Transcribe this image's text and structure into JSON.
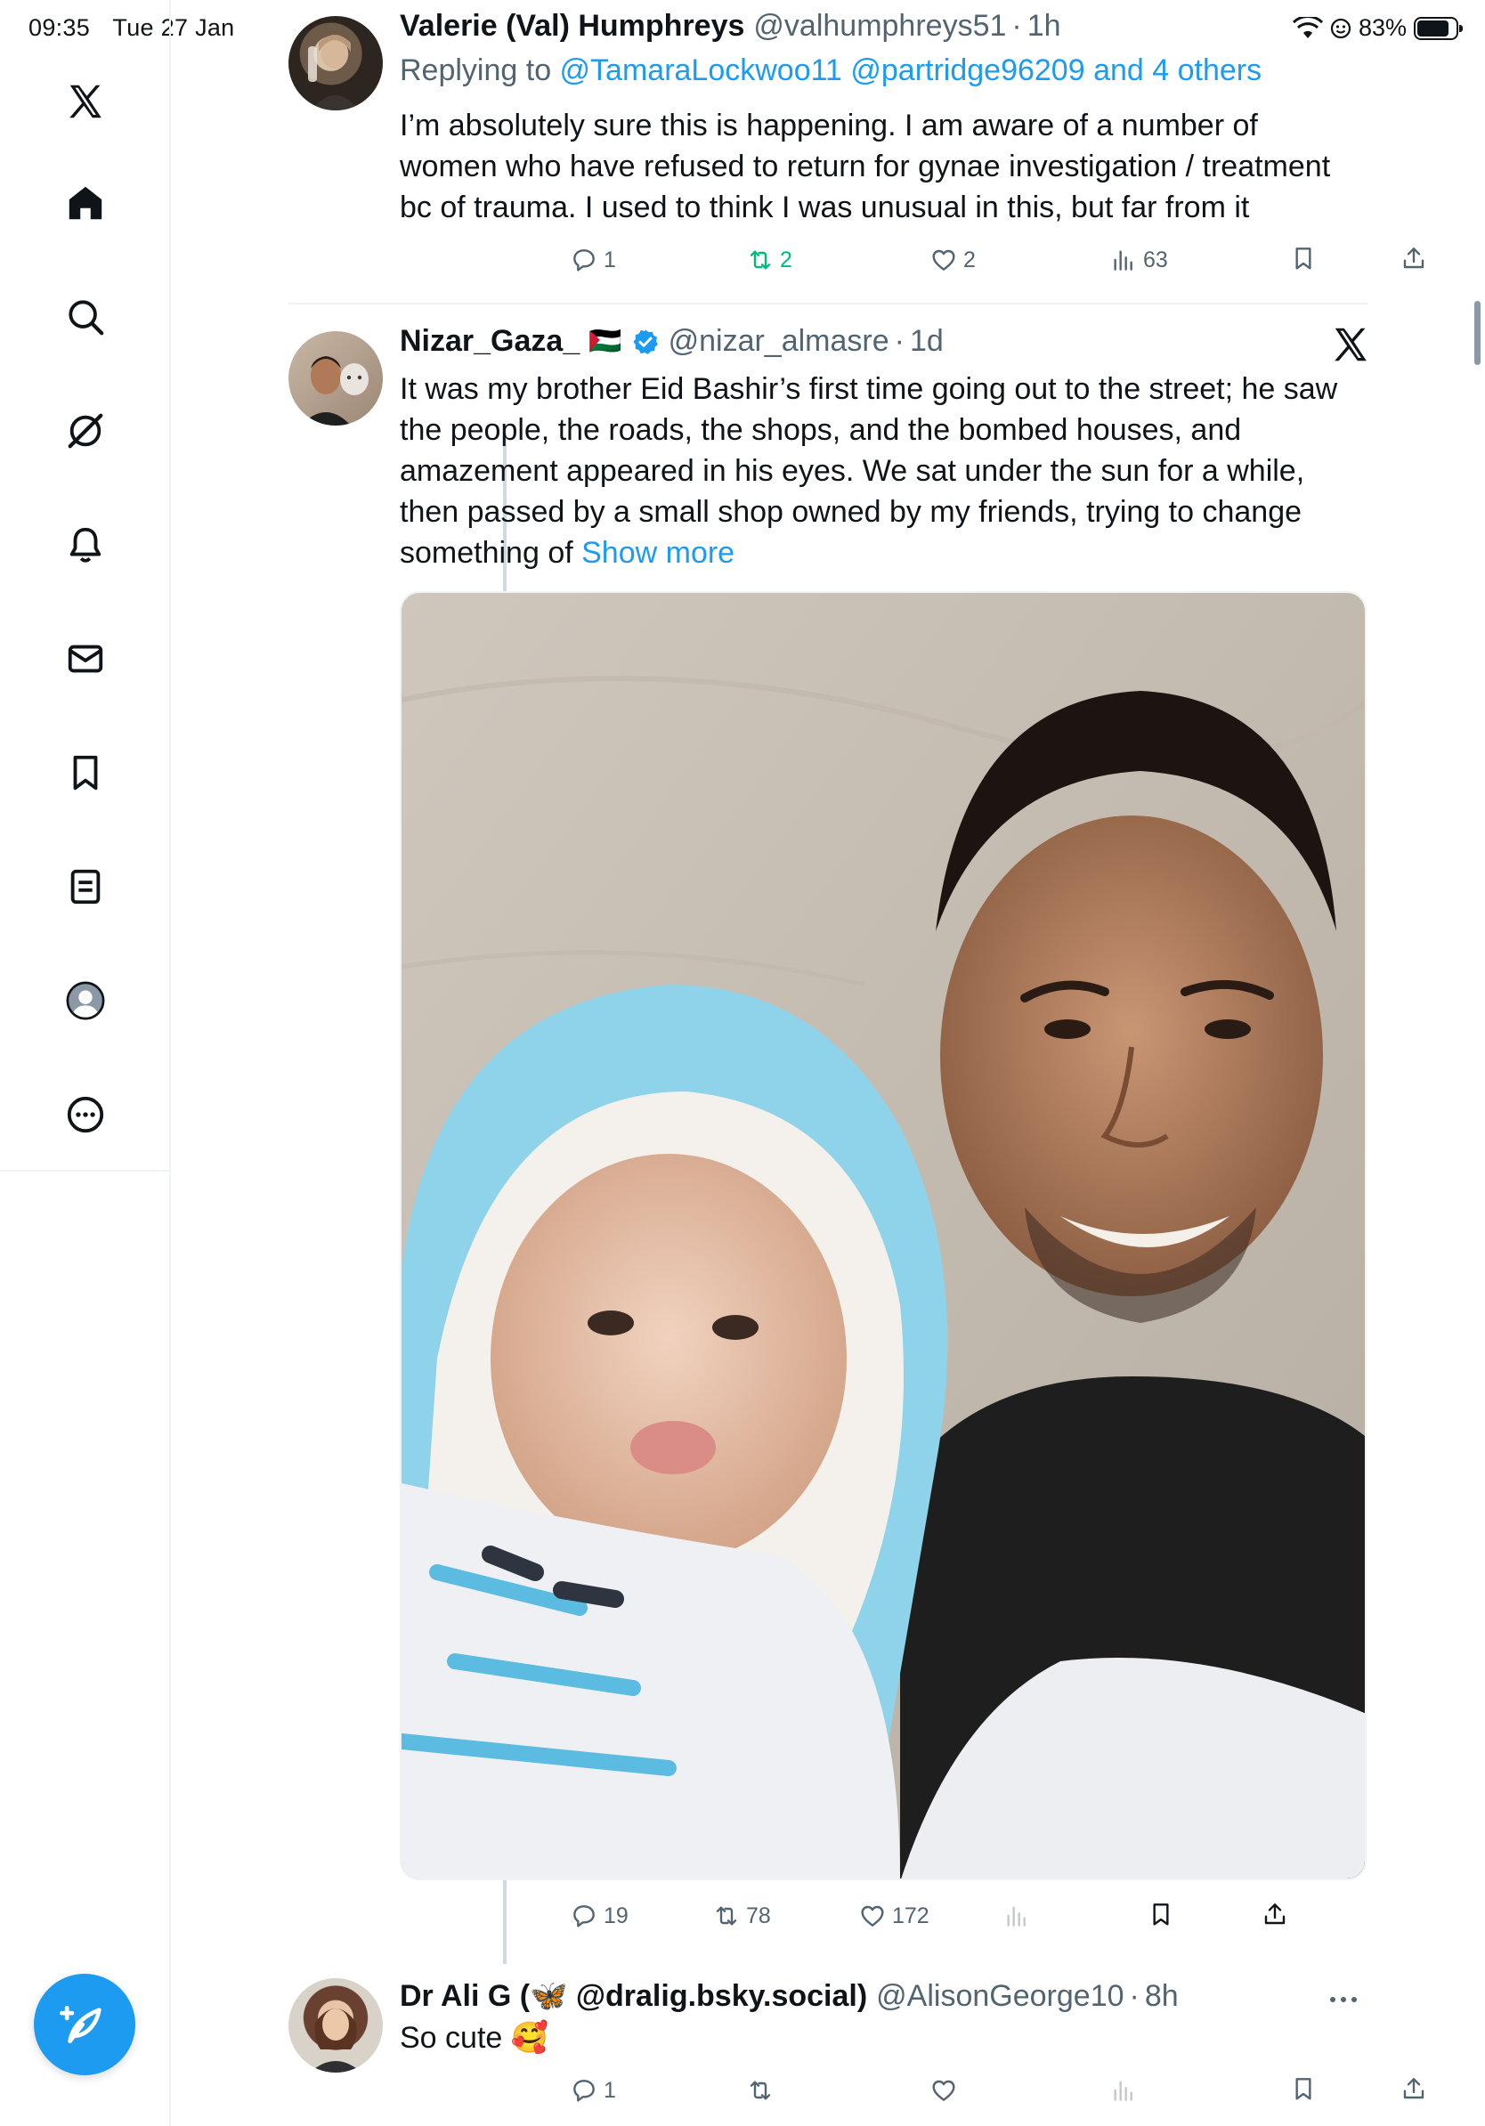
{
  "status_bar": {
    "time": "09:35",
    "date": "Tue 27 Jan",
    "battery": "83%",
    "battery_level": 0.83
  },
  "sidebar": {
    "items": [
      {
        "name": "x-logo-icon"
      },
      {
        "name": "home-icon"
      },
      {
        "name": "search-icon"
      },
      {
        "name": "grok-icon"
      },
      {
        "name": "notifications-icon"
      },
      {
        "name": "messages-icon"
      },
      {
        "name": "bookmarks-icon"
      },
      {
        "name": "lists-icon"
      },
      {
        "name": "profile-icon"
      },
      {
        "name": "more-icon"
      }
    ],
    "compose_icon": "compose-icon"
  },
  "tweets": [
    {
      "name": "Valerie (Val) Humphreys",
      "handle": "@valhumphreys51",
      "dot": "·",
      "time": "1h",
      "replying_prefix": "Replying to ",
      "replying_links": "@TamaraLockwoo11 @partridge96209 and 4 others",
      "text": "I’m absolutely sure this is happening. I am aware of a number of women who have refused to return for gynae investigation / treatment bc of trauma. I used to think I was unusual in this, but far from it",
      "replies": "1",
      "retweets": "2",
      "likes": "2",
      "views": "63"
    },
    {
      "name": "Nizar_Gaza_",
      "flag": "🇵🇸",
      "handle": "@nizar_almasre",
      "dot": "·",
      "time": "1d",
      "text": "It was my brother Eid Bashir’s first time going out to the street; he saw the people, the roads, the shops, and the bombed houses, and amazement appeared in his eyes. We sat under the sun for a while, then passed by a small shop owned by my friends, trying to change something of ",
      "show_more": "Show more",
      "replies": "19",
      "retweets": "78",
      "likes": "172",
      "views": ""
    },
    {
      "name": "Dr Ali G (🦋 @dralig.bsky.social)",
      "handle": "@AlisonGeorge10",
      "dot": "·",
      "time": "8h",
      "text": "So cute 🥰",
      "replies": "1",
      "retweets": "",
      "likes": "",
      "views": ""
    }
  ],
  "colors": {
    "accent": "#1d9bf0",
    "retweet_active": "#00ba7c",
    "muted": "#536471",
    "text": "#0f1419"
  }
}
